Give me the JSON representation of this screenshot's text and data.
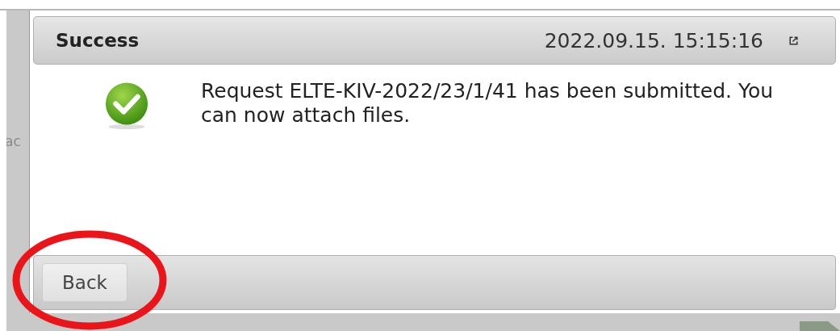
{
  "background": {
    "text_fragment": "ac"
  },
  "dialog": {
    "title": "Success",
    "timestamp": "2022.09.15. 15:15:16",
    "icon": {
      "kind": "success"
    },
    "message": "Request ELTE-KIV-2022/23/1/41 has been submitted. You can now attach files.",
    "buttons": [
      {
        "label": "Back"
      }
    ]
  },
  "annotations": [
    {
      "kind": "ellipse",
      "color": "#e8151b"
    }
  ]
}
